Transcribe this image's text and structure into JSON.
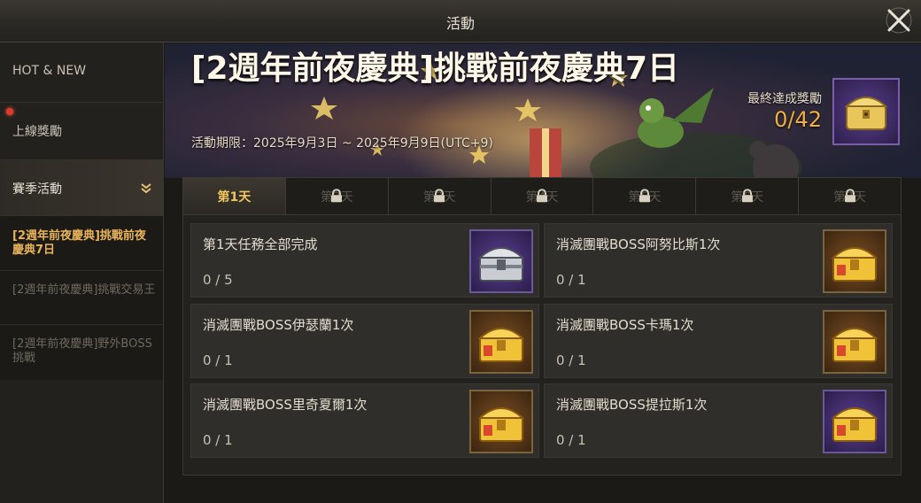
{
  "window": {
    "title": "活動"
  },
  "sidebar": {
    "categories": [
      {
        "label": "HOT & NEW"
      },
      {
        "label": "上線獎勵"
      },
      {
        "label": "賽季活動"
      }
    ],
    "sub_items": [
      {
        "label": "[2週年前夜慶典]挑戰前夜慶典7日"
      },
      {
        "label": "[2週年前夜慶典]挑戰交易王"
      },
      {
        "label": "[2週年前夜慶典]野外BOSS挑戰"
      }
    ]
  },
  "banner": {
    "title": "[2週年前夜慶典]挑戰前夜慶典7日",
    "period": "活動期限：2025年9月3日 ~ 2025年9月9日(UTC+9)",
    "final_reward_label": "最終達成獎勵",
    "final_reward_count": "0/42"
  },
  "tabs": [
    {
      "label": "第1天",
      "locked": false
    },
    {
      "label": "第2天",
      "locked": true
    },
    {
      "label": "第3天",
      "locked": true
    },
    {
      "label": "第4天",
      "locked": true
    },
    {
      "label": "第5天",
      "locked": true
    },
    {
      "label": "第6天",
      "locked": true
    },
    {
      "label": "第7天",
      "locked": true
    }
  ],
  "missions": [
    {
      "name": "第1天任務全部完成",
      "progress": "0 / 5",
      "reward_icon": "silver-chest-icon",
      "bg": "purple"
    },
    {
      "name": "消滅團戰BOSS阿努比斯1次",
      "progress": "0 / 1",
      "reward_icon": "gold-chest-icon",
      "bg": "orange"
    },
    {
      "name": "消滅團戰BOSS伊瑟蘭1次",
      "progress": "0 / 1",
      "reward_icon": "gold-chest-icon",
      "bg": "orange"
    },
    {
      "name": "消滅團戰BOSS卡瑪1次",
      "progress": "0 / 1",
      "reward_icon": "gold-chest-icon",
      "bg": "orange"
    },
    {
      "name": "消滅團戰BOSS里奇夏爾1次",
      "progress": "0 / 1",
      "reward_icon": "gold-chest-icon",
      "bg": "orange"
    },
    {
      "name": "消滅團戰BOSS提拉斯1次",
      "progress": "0 / 1",
      "reward_icon": "gold-chest-icon",
      "bg": "purple"
    }
  ],
  "colors": {
    "accent": "#f0b040",
    "active_sub": "#e9b45a",
    "notification": "#e23b2a"
  }
}
